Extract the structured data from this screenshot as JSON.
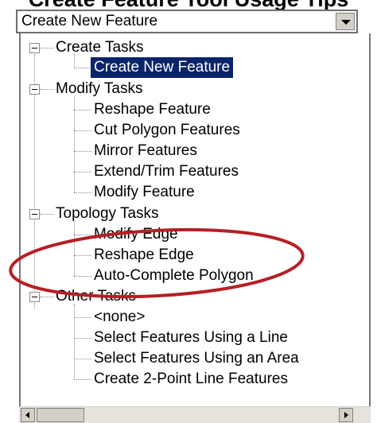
{
  "banner": {
    "partial_text": "Create Feature Tool Usage Tips"
  },
  "combo": {
    "selected_value": "Create New Feature"
  },
  "tree": {
    "groups": [
      {
        "label": "Create Tasks",
        "items": [
          "Create New Feature"
        ]
      },
      {
        "label": "Modify Tasks",
        "items": [
          "Reshape Feature",
          "Cut Polygon Features",
          "Mirror Features",
          "Extend/Trim Features",
          "Modify Feature"
        ]
      },
      {
        "label": "Topology Tasks",
        "items": [
          "Modify Edge",
          "Reshape Edge",
          "Auto-Complete Polygon"
        ]
      },
      {
        "label": "Other Tasks",
        "items": [
          "<none>",
          "Select Features Using a Line",
          "Select Features Using an Area",
          "Create 2-Point Line Features"
        ]
      }
    ]
  },
  "selected_item": "Create New Feature",
  "colors": {
    "selection_bg": "#0a246a",
    "selection_text": "#ffffff",
    "annotation_ellipse": "#b52025",
    "panel_border": "#777777",
    "button_face": "#d4d0c8"
  },
  "icons": {
    "combo": "chevron-down-icon",
    "expanders": "collapse-minus-icon",
    "scroll_left": "arrow-left-icon",
    "scroll_right": "arrow-right-icon"
  }
}
